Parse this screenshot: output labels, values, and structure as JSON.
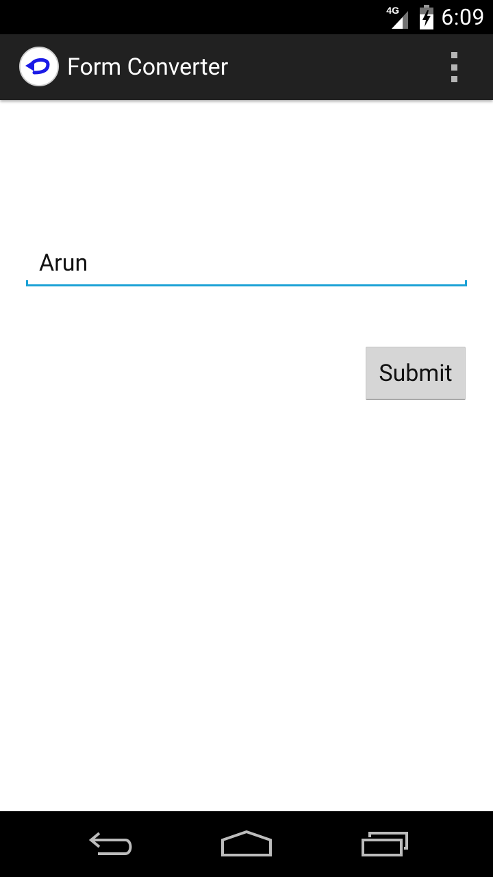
{
  "status_bar": {
    "network_type": "4G",
    "time": "6:09",
    "icons": [
      "signal-icon",
      "battery-charging-icon"
    ]
  },
  "action_bar": {
    "title": "Form Converter",
    "logo_icon": "back-arrow-logo-icon",
    "menu_icon": "overflow-menu-icon"
  },
  "form": {
    "name_field_value": "Arun",
    "submit_label": "Submit"
  },
  "nav_bar": {
    "icons": [
      "back-icon",
      "home-icon",
      "recent-apps-icon"
    ]
  },
  "colors": {
    "status_bar_bg": "#000000",
    "action_bar_bg": "#212121",
    "field_underline": "#1ba1d6",
    "button_bg": "#d6d6d6",
    "logo_arrow": "#1a1ae6"
  }
}
